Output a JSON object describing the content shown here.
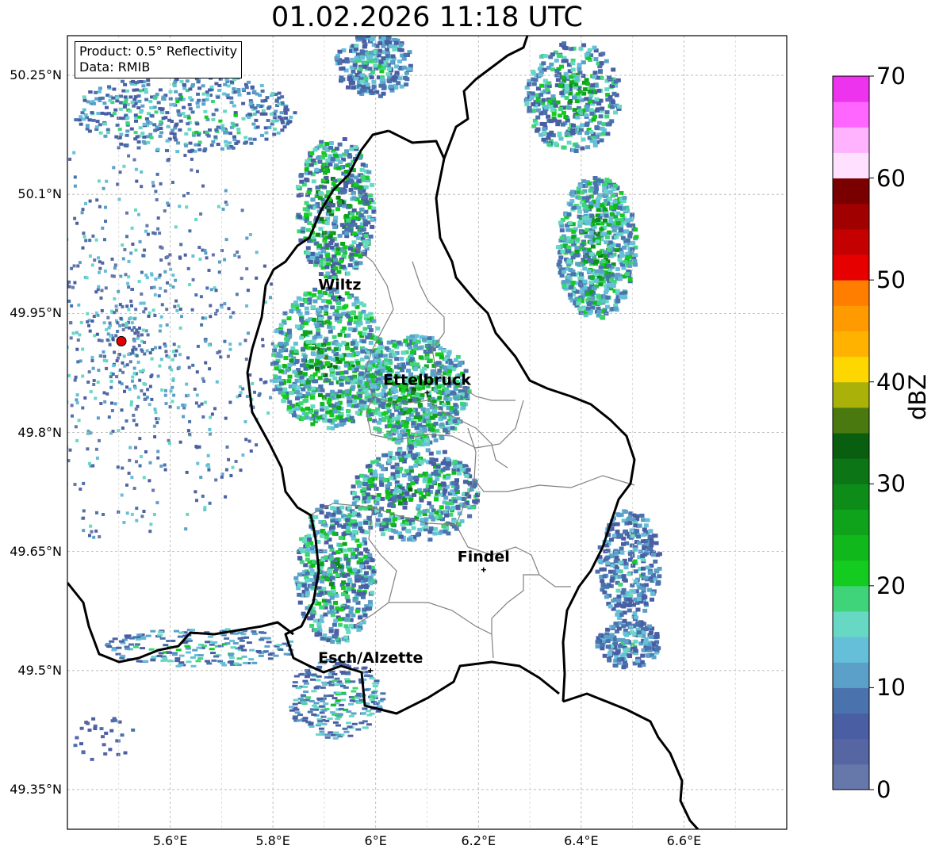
{
  "title": "01.02.2026 11:18 UTC",
  "info": {
    "product": "Product: 0.5° Reflectivity",
    "source": "Data: RMIB"
  },
  "axes": {
    "y_labels": [
      "50.25°N",
      "50.1°N",
      "49.95°N",
      "49.8°N",
      "49.65°N",
      "49.5°N",
      "49.35°N"
    ],
    "x_labels": [
      "5.6°E",
      "5.8°E",
      "6°E",
      "6.2°E",
      "6.4°E",
      "6.6°E"
    ],
    "grid": true,
    "lat_range": [
      49.3,
      50.3
    ],
    "lon_range": [
      5.4,
      6.8
    ]
  },
  "cities": [
    {
      "name": "Wiltz",
      "lon": 5.93,
      "lat": 49.97
    },
    {
      "name": "Ettelbruck",
      "lon": 6.1,
      "lat": 49.85
    },
    {
      "name": "Findel",
      "lon": 6.21,
      "lat": 49.627
    },
    {
      "name": "Esch/Alzette",
      "lon": 5.99,
      "lat": 49.5
    }
  ],
  "radar_site": {
    "lon": 5.505,
    "lat": 49.915,
    "color": "#e00000"
  },
  "colorbar": {
    "label": "dBZ",
    "ticks": [
      "70",
      "60",
      "50",
      "40",
      "30",
      "20",
      "10",
      "0"
    ],
    "min": 0,
    "max": 70,
    "step": 2.5,
    "colors": [
      "#6677aa",
      "#5566a3",
      "#4a5ea3",
      "#4a73ae",
      "#5aa0c8",
      "#66bfd9",
      "#66d8c4",
      "#40d47a",
      "#13cc1f",
      "#10b81c",
      "#0fa21b",
      "#0e8c1a",
      "#0c7616",
      "#095e10",
      "#4a7a0f",
      "#aab20a",
      "#ffd700",
      "#ffb300",
      "#ff9a00",
      "#ff7e00",
      "#e60000",
      "#c40000",
      "#a00000",
      "#7a0000",
      "#ffe0ff",
      "#ffb3ff",
      "#ff66ff",
      "#ee33ee"
    ]
  }
}
